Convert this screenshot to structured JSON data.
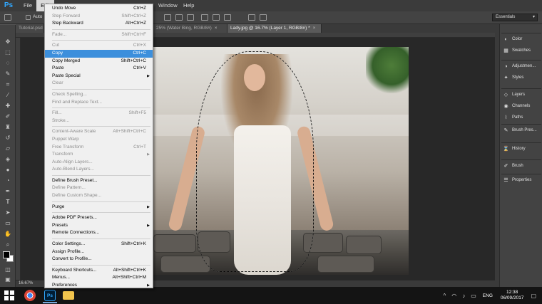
{
  "app": {
    "logo": "Ps"
  },
  "menubar": {
    "items": [
      "File",
      "Edit"
    ],
    "window_label": "Window",
    "help_label": "Help"
  },
  "options": {
    "auto_label": "Auto",
    "workspace": "Essentials"
  },
  "tabs": [
    {
      "label": "Tutorial.psd"
    },
    {
      "label": "25% (Water Bing, RGB/8#)"
    },
    {
      "label": "Lady.jpg @ 16.7% (Layer 1, RGB/8#) *"
    }
  ],
  "status": {
    "zoom": "16.67%"
  },
  "edit_menu": {
    "groups": [
      [
        {
          "label": "Undo Move",
          "shortcut": "Ctrl+Z",
          "enabled": true
        },
        {
          "label": "Step Forward",
          "shortcut": "Shift+Ctrl+Z",
          "enabled": false
        },
        {
          "label": "Step Backward",
          "shortcut": "Alt+Ctrl+Z",
          "enabled": true
        }
      ],
      [
        {
          "label": "Fade...",
          "shortcut": "Shift+Ctrl+F",
          "enabled": false
        }
      ],
      [
        {
          "label": "Cut",
          "shortcut": "Ctrl+X",
          "enabled": false
        },
        {
          "label": "Copy",
          "shortcut": "Ctrl+C",
          "enabled": true,
          "highlighted": true
        },
        {
          "label": "Copy Merged",
          "shortcut": "Shift+Ctrl+C",
          "enabled": true
        },
        {
          "label": "Paste",
          "shortcut": "Ctrl+V",
          "enabled": true
        },
        {
          "label": "Paste Special",
          "shortcut": "",
          "enabled": true,
          "submenu": true
        },
        {
          "label": "Clear",
          "shortcut": "",
          "enabled": false
        }
      ],
      [
        {
          "label": "Check Spelling...",
          "shortcut": "",
          "enabled": false
        },
        {
          "label": "Find and Replace Text...",
          "shortcut": "",
          "enabled": false
        }
      ],
      [
        {
          "label": "Fill...",
          "shortcut": "Shift+F5",
          "enabled": false
        },
        {
          "label": "Stroke...",
          "shortcut": "",
          "enabled": false
        }
      ],
      [
        {
          "label": "Content-Aware Scale",
          "shortcut": "Alt+Shift+Ctrl+C",
          "enabled": false
        },
        {
          "label": "Puppet Warp",
          "shortcut": "",
          "enabled": false
        },
        {
          "label": "Free Transform",
          "shortcut": "Ctrl+T",
          "enabled": false
        },
        {
          "label": "Transform",
          "shortcut": "",
          "enabled": false,
          "submenu": true
        },
        {
          "label": "Auto-Align Layers...",
          "shortcut": "",
          "enabled": false
        },
        {
          "label": "Auto-Blend Layers...",
          "shortcut": "",
          "enabled": false
        }
      ],
      [
        {
          "label": "Define Brush Preset...",
          "shortcut": "",
          "enabled": true
        },
        {
          "label": "Define Pattern...",
          "shortcut": "",
          "enabled": false
        },
        {
          "label": "Define Custom Shape...",
          "shortcut": "",
          "enabled": false
        }
      ],
      [
        {
          "label": "Purge",
          "shortcut": "",
          "enabled": true,
          "submenu": true
        }
      ],
      [
        {
          "label": "Adobe PDF Presets...",
          "shortcut": "",
          "enabled": true
        },
        {
          "label": "Presets",
          "shortcut": "",
          "enabled": true,
          "submenu": true
        },
        {
          "label": "Remote Connections...",
          "shortcut": "",
          "enabled": true
        }
      ],
      [
        {
          "label": "Color Settings...",
          "shortcut": "Shift+Ctrl+K",
          "enabled": true
        },
        {
          "label": "Assign Profile...",
          "shortcut": "",
          "enabled": true
        },
        {
          "label": "Convert to Profile...",
          "shortcut": "",
          "enabled": true
        }
      ],
      [
        {
          "label": "Keyboard Shortcuts...",
          "shortcut": "Alt+Shift+Ctrl+K",
          "enabled": true
        },
        {
          "label": "Menus...",
          "shortcut": "Alt+Shift+Ctrl+M",
          "enabled": true
        },
        {
          "label": "Preferences",
          "shortcut": "",
          "enabled": true,
          "submenu": true
        }
      ]
    ]
  },
  "panels": {
    "groups": [
      [
        {
          "label": "Color",
          "icon": "color-icon"
        },
        {
          "label": "Swatches",
          "icon": "swatches-icon"
        }
      ],
      [
        {
          "label": "Adjustmen...",
          "icon": "adjustments-icon"
        },
        {
          "label": "Styles",
          "icon": "styles-icon"
        }
      ],
      [
        {
          "label": "Layers",
          "icon": "layers-icon"
        },
        {
          "label": "Channels",
          "icon": "channels-icon"
        },
        {
          "label": "Paths",
          "icon": "paths-icon"
        }
      ],
      [
        {
          "label": "Brush Pres...",
          "icon": "brush-presets-icon"
        }
      ],
      [
        {
          "label": "History",
          "icon": "history-icon"
        }
      ],
      [
        {
          "label": "Brush",
          "icon": "brush-icon"
        }
      ],
      [
        {
          "label": "Properties",
          "icon": "properties-icon"
        }
      ]
    ]
  },
  "taskbar": {
    "apps": [
      {
        "name": "chrome-icon",
        "label": ""
      },
      {
        "name": "photoshop-icon",
        "label": "Ps"
      },
      {
        "name": "file-explorer-icon",
        "label": ""
      }
    ],
    "language": "ENG",
    "time": "12:38",
    "date": "06/09/2017"
  },
  "colors": {
    "menu_highlight": "#3c8fdc",
    "ps_blue": "#31a8ff",
    "panel_bg": "#434343"
  }
}
